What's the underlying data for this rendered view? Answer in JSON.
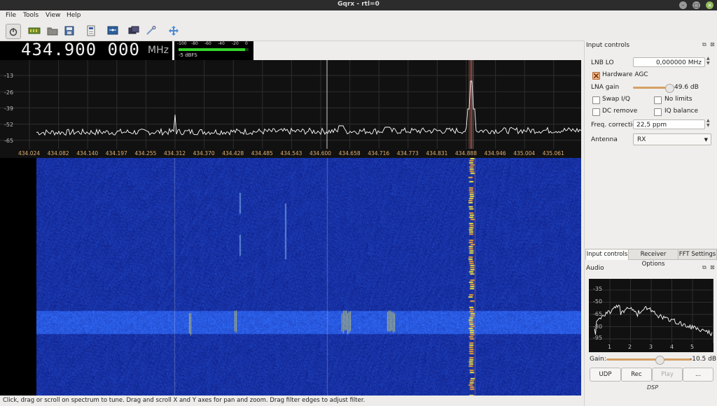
{
  "window": {
    "title": "Gqrx - rtl=0"
  },
  "menu": [
    "File",
    "Tools",
    "View",
    "Help"
  ],
  "toolbar_icons": [
    "power-icon",
    "hardware-icon",
    "folder-icon",
    "save-icon",
    "document-icon",
    "device-config-icon",
    "screen-icon",
    "tools-icon",
    "move-icon"
  ],
  "frequency": {
    "value": "434.900 000",
    "unit": "MHz"
  },
  "meter": {
    "ticks": [
      "-100",
      "-80",
      "-60",
      "-40",
      "-20",
      "0"
    ],
    "readout": "-5 dBFS",
    "level_fraction": 0.95
  },
  "spectrum": {
    "y_ticks": [
      "-13",
      "-26",
      "-39",
      "-52",
      "-65"
    ],
    "x_ticks": [
      "434.024",
      "434.082",
      "434.140",
      "434.197",
      "434.255",
      "434.312",
      "434.370",
      "434.428",
      "434.485",
      "434.543",
      "434.600",
      "434.658",
      "434.716",
      "434.773",
      "434.831",
      "434.888",
      "434.946",
      "435.004",
      "435.061"
    ]
  },
  "status": {
    "text": "Click, drag or scroll on spectrum to tune. Drag and scroll X and Y axes for pan and zoom. Drag filter edges to adjust filter."
  },
  "input_controls": {
    "title": "Input controls",
    "lnb_lo_label": "LNB LO",
    "lnb_lo_value": "0,000000 MHz",
    "hardware_agc_label": "Hardware AGC",
    "lna_gain_label": "LNA gain",
    "lna_gain_value": "49.6 dB",
    "lna_gain_fraction": 0.93,
    "swap_iq_label": "Swap I/Q",
    "no_limits_label": "No limits",
    "dc_remove_label": "DC remove",
    "iq_balance_label": "IQ balance",
    "freq_correction_label": "Freq. correction",
    "freq_correction_value": "22,5 ppm",
    "antenna_label": "Antenna",
    "antenna_value": "RX"
  },
  "tabs": [
    "Input controls",
    "Receiver Options",
    "FFT Settings"
  ],
  "audio": {
    "title": "Audio",
    "y_ticks": [
      "-35",
      "-50",
      "-65",
      "-80",
      "-95"
    ],
    "x_ticks": [
      "1",
      "2",
      "3",
      "4",
      "5"
    ],
    "gain_label": "Gain:",
    "gain_value": "-10.5 dB",
    "gain_fraction": 0.62,
    "buttons": [
      "UDP",
      "Rec",
      "Play",
      "..."
    ],
    "footer": "DSP"
  },
  "colors": {
    "accent": "#d4a066",
    "meter_green": "#36d52b",
    "waterfall_blue": "#0a1ea8",
    "signal_yellow": "#f2e33a",
    "tick_orange": "#e0b070"
  }
}
